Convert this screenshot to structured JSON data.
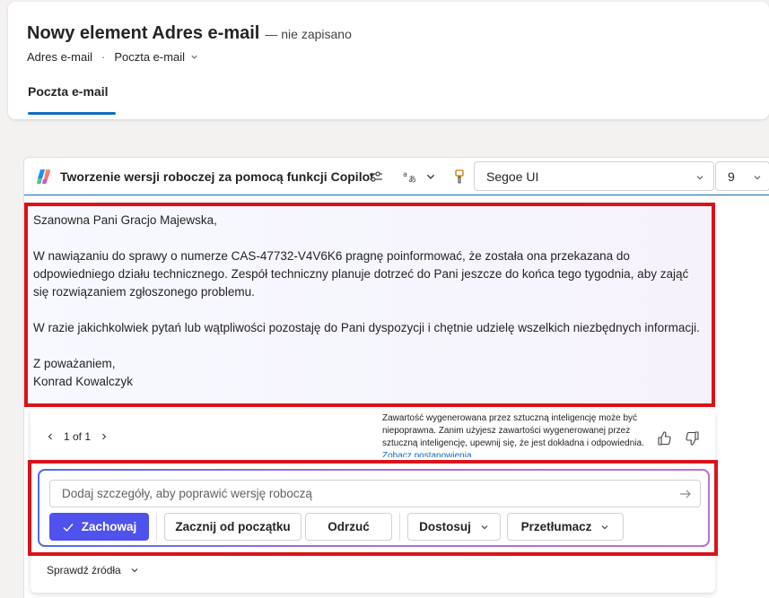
{
  "header": {
    "title": "Nowy element Adres e-mail",
    "status": "— nie zapisano",
    "breadcrumb_entity": "Adres e-mail",
    "breadcrumb_form": "Poczta e-mail",
    "active_tab": "Poczta e-mail"
  },
  "toolbar": {
    "copilot_title": "Tworzenie wersji roboczej za pomocą funkcji Copilot",
    "font_family_value": "Segoe UI",
    "font_size_value": "9",
    "icons": [
      "sliders-icon",
      "translate-icon",
      "chevron-down-icon",
      "format-painter-icon"
    ]
  },
  "draft": {
    "greeting": "Szanowna Pani Gracjo Majewska,",
    "paragraph1": "W nawiązaniu do sprawy o numerze CAS-47732-V4V6K6 pragnę poinformować, że została ona przekazana do odpowiedniego działu technicznego. Zespół techniczny planuje dotrzeć do Pani jeszcze do końca tego tygodnia, aby zająć się rozwiązaniem zgłoszonego problemu.",
    "paragraph2": "W razie jakichkolwiek pytań lub wątpliwości pozostaję do Pani dyspozycji i chętnie udzielę wszelkich niezbędnych informacji.",
    "closing": "Z poważaniem,",
    "signature": "Konrad Kowalczyk"
  },
  "feedback": {
    "pager_text": "1 of 1",
    "disclaimer": "Zawartość wygenerowana przez sztuczną inteligencję może być niepoprawna. Zanim użyjesz zawartości wygenerowanej przez sztuczną inteligencję, upewnij się, że jest dokładna i odpowiednia.",
    "disclaimer_link": "Zobacz postanowienia"
  },
  "refine": {
    "placeholder": "Dodaj szczegóły, aby poprawić wersję roboczą",
    "keep_label": "Zachowaj",
    "start_over_label": "Zacznij od początku",
    "discard_label": "Odrzuć",
    "adjust_label": "Dostosuj",
    "translate_label": "Przetłumacz"
  },
  "sources": {
    "label": "Sprawdź źródła"
  },
  "colors": {
    "accent": "#0f6cbd",
    "primary_button": "#4f52ec",
    "highlight_border": "#d9131b"
  }
}
